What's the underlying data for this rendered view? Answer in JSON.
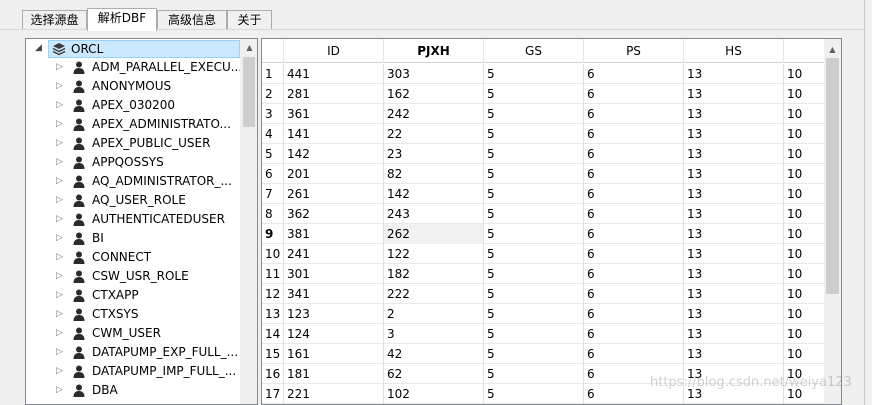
{
  "tabs": [
    {
      "label": "选择源盘",
      "active": false
    },
    {
      "label": "解析DBF",
      "active": true
    },
    {
      "label": "高级信息",
      "active": false
    },
    {
      "label": "关于",
      "active": false
    }
  ],
  "tree": {
    "root": {
      "label": "ORCL",
      "icon": "database-stack-icon",
      "expanded": true,
      "selected": true
    },
    "items": [
      "ADM_PARALLEL_EXECU...",
      "ANONYMOUS",
      "APEX_030200",
      "APEX_ADMINISTRATO...",
      "APEX_PUBLIC_USER",
      "APPQOSSYS",
      "AQ_ADMINISTRATOR_...",
      "AQ_USER_ROLE",
      "AUTHENTICATEDUSER",
      "BI",
      "CONNECT",
      "CSW_USR_ROLE",
      "CTXAPP",
      "CTXSYS",
      "CWM_USER",
      "DATAPUMP_EXP_FULL_...",
      "DATAPUMP_IMP_FULL_...",
      "DBA"
    ],
    "item_icon": "user-icon"
  },
  "grid": {
    "columns": [
      "ID",
      "PJXH",
      "GS",
      "PS",
      "HS",
      ""
    ],
    "sorted_column": "PJXH",
    "current_row": 9,
    "rows": [
      {
        "n": "1",
        "cells": [
          "441",
          "303",
          "5",
          "6",
          "13",
          "10"
        ]
      },
      {
        "n": "2",
        "cells": [
          "281",
          "162",
          "5",
          "6",
          "13",
          "10"
        ]
      },
      {
        "n": "3",
        "cells": [
          "361",
          "242",
          "5",
          "6",
          "13",
          "10"
        ]
      },
      {
        "n": "4",
        "cells": [
          "141",
          "22",
          "5",
          "6",
          "13",
          "10"
        ]
      },
      {
        "n": "5",
        "cells": [
          "142",
          "23",
          "5",
          "6",
          "13",
          "10"
        ]
      },
      {
        "n": "6",
        "cells": [
          "201",
          "82",
          "5",
          "6",
          "13",
          "10"
        ]
      },
      {
        "n": "7",
        "cells": [
          "261",
          "142",
          "5",
          "6",
          "13",
          "10"
        ]
      },
      {
        "n": "8",
        "cells": [
          "362",
          "243",
          "5",
          "6",
          "13",
          "10"
        ]
      },
      {
        "n": "9",
        "cells": [
          "381",
          "262",
          "5",
          "6",
          "13",
          "10"
        ]
      },
      {
        "n": "10",
        "cells": [
          "241",
          "122",
          "5",
          "6",
          "13",
          "10"
        ]
      },
      {
        "n": "11",
        "cells": [
          "301",
          "182",
          "5",
          "6",
          "13",
          "10"
        ]
      },
      {
        "n": "12",
        "cells": [
          "341",
          "222",
          "5",
          "6",
          "13",
          "10"
        ]
      },
      {
        "n": "13",
        "cells": [
          "123",
          "2",
          "5",
          "6",
          "13",
          "10"
        ]
      },
      {
        "n": "14",
        "cells": [
          "124",
          "3",
          "5",
          "6",
          "13",
          "10"
        ]
      },
      {
        "n": "15",
        "cells": [
          "161",
          "42",
          "5",
          "6",
          "13",
          "10"
        ]
      },
      {
        "n": "16",
        "cells": [
          "181",
          "62",
          "5",
          "6",
          "13",
          "10"
        ]
      },
      {
        "n": "17",
        "cells": [
          "221",
          "102",
          "5",
          "6",
          "13",
          "10"
        ]
      }
    ]
  },
  "watermark": "https://blog.csdn.net/weiya123",
  "colors": {
    "selection_bg": "#cce8ff",
    "selection_border": "#99d1ff",
    "border": "#828790",
    "window_bg": "#f0f0f0"
  }
}
